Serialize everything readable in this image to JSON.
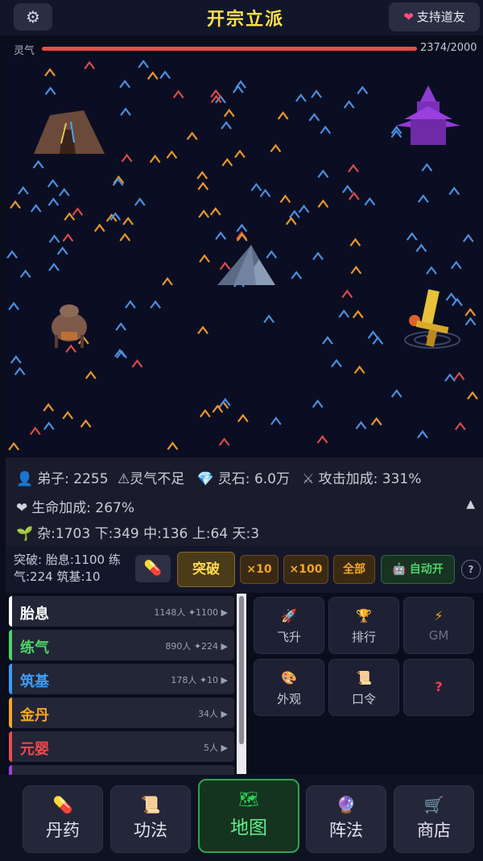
{
  "header": {
    "title": "开宗立派",
    "settings_icon": "gear-icon",
    "support_label": "支持道友"
  },
  "qi": {
    "label": "灵气",
    "value": "2374/2000",
    "fill_fraction": 1.0
  },
  "stats": {
    "disciples": "弟子: 2255",
    "warning": "⚠灵气不足",
    "spirit_stones": "灵石: 6.0万",
    "attack_bonus": "攻击加成: 331%",
    "life_bonus": "生命加成: 267%",
    "roots": "杂:1703 下:349 中:136 上:64 天:3",
    "collapse_icon": "▲"
  },
  "breakthrough": {
    "requirement": "突破: 胎息:1100 练气:224 筑基:10",
    "button": "突破",
    "x10": "×10",
    "x100": "×100",
    "all": "全部",
    "auto": "自动开",
    "help": "?"
  },
  "realms": [
    {
      "name": "胎息",
      "stat": "1148人 ✦1100 ▶",
      "color": "#ffffff"
    },
    {
      "name": "练气",
      "stat": "890人 ✦224 ▶",
      "color": "#4cd46a"
    },
    {
      "name": "筑基",
      "stat": "178人 ✦10 ▶",
      "color": "#3b9cf5"
    },
    {
      "name": "金丹",
      "stat": "34人 ▶",
      "color": "#f5a623"
    },
    {
      "name": "元婴",
      "stat": "5人 ▶",
      "color": "#ee4b4b"
    }
  ],
  "actions": [
    {
      "label": "飞升",
      "icon": "rocket-icon"
    },
    {
      "label": "排行",
      "icon": "trophy-icon"
    },
    {
      "label": "GM",
      "icon": "lightning-icon"
    },
    {
      "label": "外观",
      "icon": "palette-icon"
    },
    {
      "label": "口令",
      "icon": "scroll-icon"
    },
    {
      "label": "?",
      "icon": "question-icon"
    }
  ],
  "nav": [
    {
      "label": "丹药",
      "icon": "pill-icon"
    },
    {
      "label": "功法",
      "icon": "scroll-icon"
    },
    {
      "label": "地图",
      "icon": "world-map-icon",
      "active": true
    },
    {
      "label": "阵法",
      "icon": "crystal-ball-icon"
    },
    {
      "label": "商店",
      "icon": "cart-icon"
    }
  ],
  "colors": {
    "accent_gold": "#ffe14d",
    "qi_bar": "#ee4b4b",
    "active_nav": "#2fa354"
  }
}
